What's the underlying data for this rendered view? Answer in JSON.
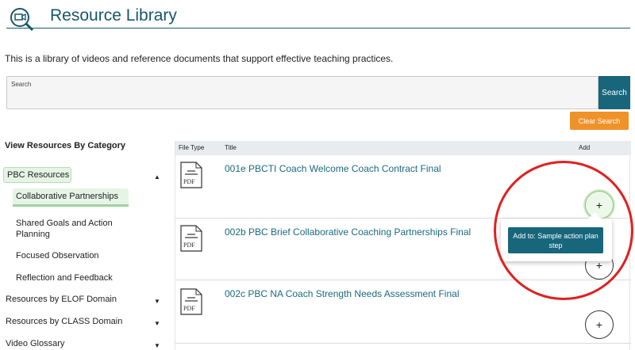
{
  "header": {
    "title": "Resource Library",
    "icon": "video-search-icon"
  },
  "intro_text": "This is a library of videos and reference documents that support effective teaching practices.",
  "search": {
    "label": "Search",
    "value": "",
    "button_label": "Search",
    "clear_label": "Clear Search"
  },
  "sidebar": {
    "heading": "View Resources By Category",
    "items": [
      {
        "label": "PBC Resources",
        "level": 0,
        "expanded": true
      },
      {
        "label": "Collaborative Partnerships",
        "level": 1,
        "selected": true
      },
      {
        "label": "Shared Goals and Action Planning",
        "level": 1
      },
      {
        "label": "Focused Observation",
        "level": 1
      },
      {
        "label": "Reflection and Feedback",
        "level": 1
      },
      {
        "label": "Resources by ELOF Domain",
        "level": 0,
        "expanded": false
      },
      {
        "label": "Resources by CLASS Domain",
        "level": 0,
        "expanded": false
      },
      {
        "label": "Video Glossary",
        "level": 0,
        "expanded": false
      }
    ]
  },
  "table": {
    "columns": [
      "File Type",
      "Title",
      "Add"
    ],
    "rows": [
      {
        "file_type": "PDF",
        "title": "001e PBCTI Coach Welcome Coach Contract Final",
        "add": "+"
      },
      {
        "file_type": "PDF",
        "title": "002b PBC Brief Collaborative Coaching Partnerships Final",
        "add": "+"
      },
      {
        "file_type": "PDF",
        "title": "002c PBC NA Coach Strength Needs Assessment Final",
        "add": "+"
      }
    ]
  },
  "popover": {
    "button_label": "Add to: Sample action plan step"
  },
  "colors": {
    "primary": "#17667c",
    "accent": "#f0922a",
    "highlight": "#e02020",
    "selected_bg": "#e6f4e6"
  }
}
